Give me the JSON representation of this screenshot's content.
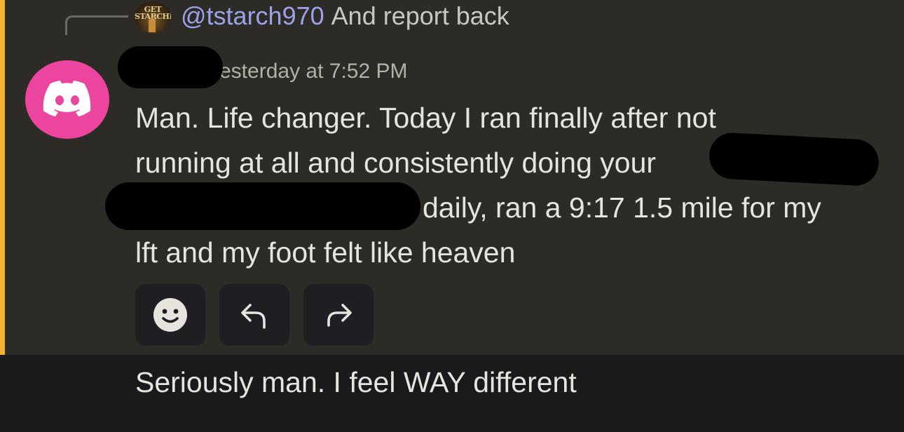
{
  "reply_preview": {
    "avatar_text": "GET STARCHED",
    "mention": "@tstarch970",
    "text": "And report back"
  },
  "message": {
    "author_redacted": true,
    "timestamp": "esterday at 7:52 PM",
    "line1": "Man. Life changer. Today I ran finally after not",
    "line2": "running at all and consistently doing your",
    "line3": "daily, ran a 9:17 1.5 mile for my",
    "line4": "lft and my foot felt like heaven"
  },
  "actions": {
    "icons": [
      "add-reaction-icon",
      "reply-icon",
      "forward-icon"
    ]
  },
  "next_message": {
    "text": "Seriously man. I feel WAY different"
  },
  "colors": {
    "accent_bar": "#f0b232",
    "avatar_bg": "#eb459f",
    "mention": "#9aa3e8",
    "highlight_bg": "#2d2b25",
    "next_bg": "#1a1a1d"
  }
}
